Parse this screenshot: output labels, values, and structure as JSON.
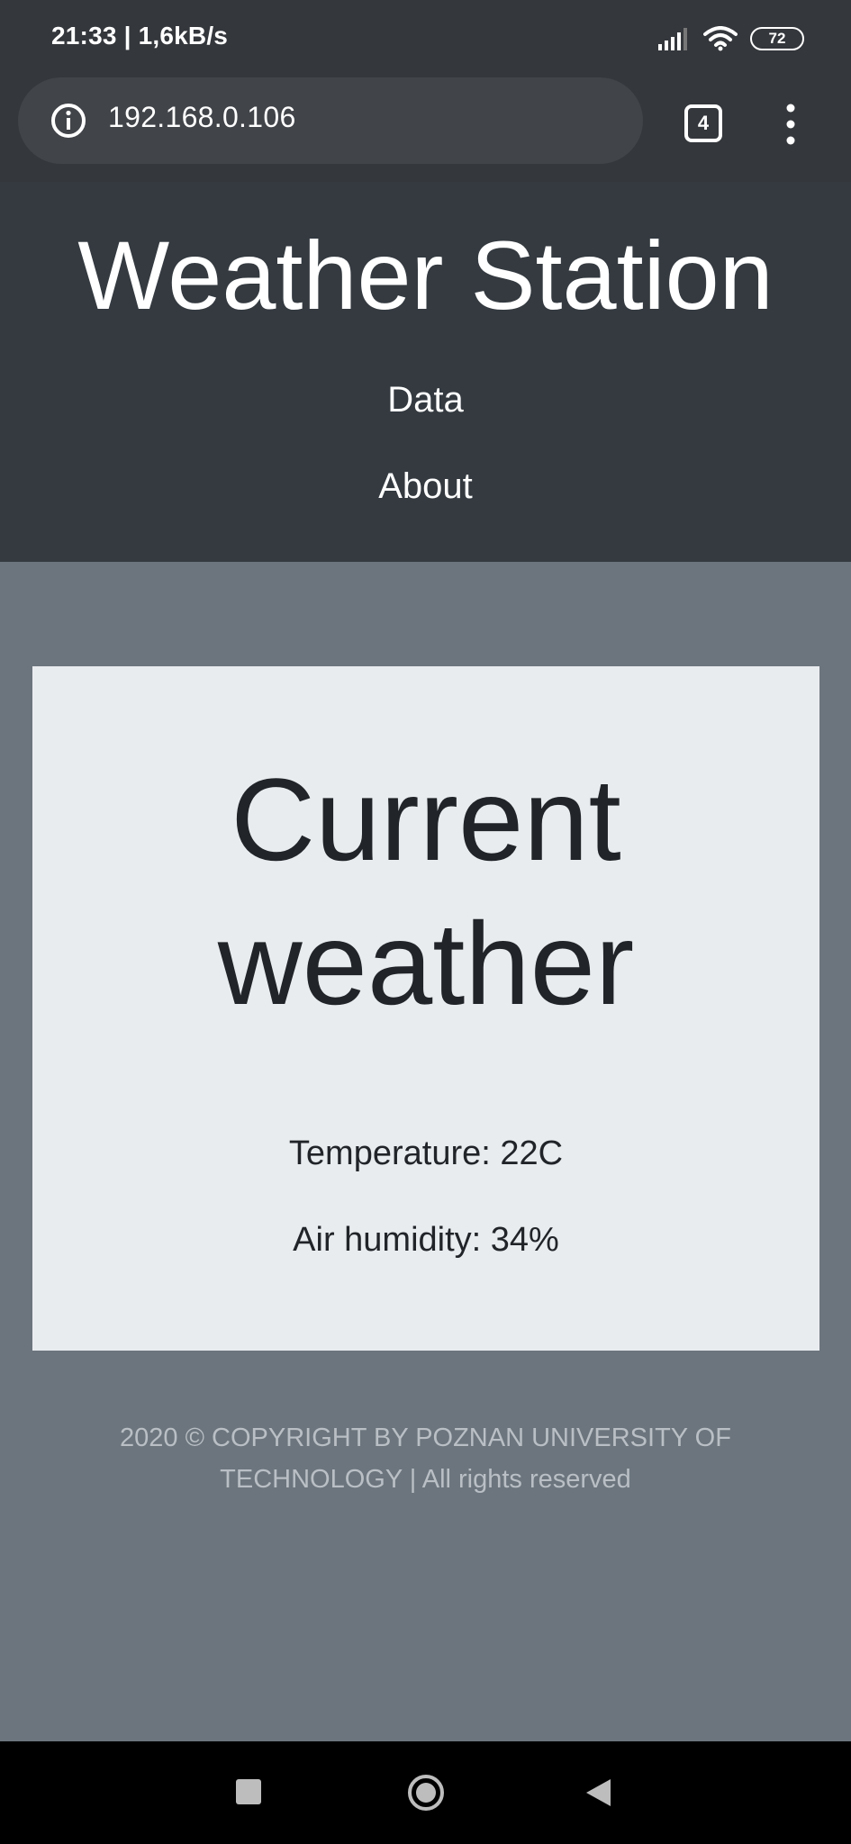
{
  "status_bar": {
    "time_speed": "21:33 | 1,6kB/s",
    "battery_level": "72",
    "icons": [
      "signal-icon",
      "wifi-icon",
      "battery-icon"
    ]
  },
  "browser": {
    "url": "192.168.0.106",
    "tab_count": "4",
    "icons": [
      "info-icon",
      "tabs-icon",
      "menu-icon"
    ]
  },
  "header": {
    "title": "Weather Station",
    "nav": [
      {
        "label": "Data"
      },
      {
        "label": "About"
      }
    ]
  },
  "main": {
    "card_title": "Current weather",
    "temperature": "Temperature: 22C",
    "humidity": "Air humidity: 34%"
  },
  "footer": {
    "line1": "2020 © COPYRIGHT BY POZNAN UNIVERSITY OF",
    "line2": "TECHNOLOGY | All rights reserved"
  },
  "colors": {
    "header_bg": "#343a40",
    "page_bg": "#6c757d",
    "card_bg": "#e9ecef",
    "footer_text": "#b9bfc5"
  }
}
